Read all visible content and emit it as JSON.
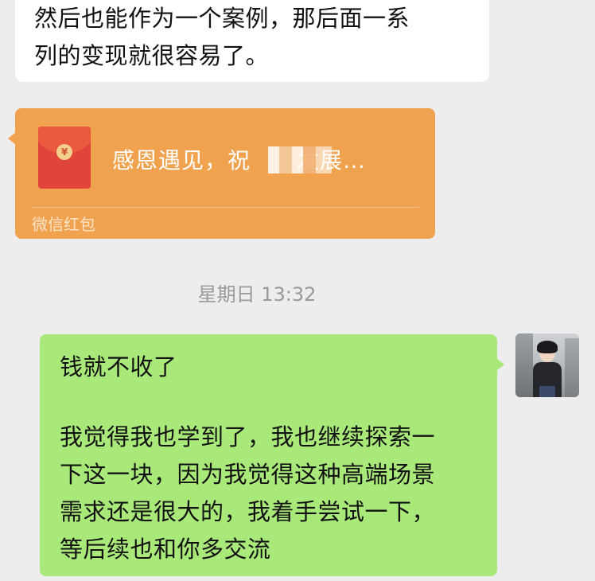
{
  "incoming_text": {
    "lines": [
      "然后也能作为一个案例，那后面一系",
      "列的变现就很容易了。"
    ]
  },
  "red_packet": {
    "title": "感恩遇见，祝",
    "title_end": "发展…",
    "footer": "微信红包",
    "icon": "red-envelope-icon",
    "colors": {
      "card": "#f0a24f",
      "envelope": "#e0443a"
    }
  },
  "timestamp": "星期日 13:32",
  "outgoing_message": {
    "lines": [
      "钱就不收了",
      "",
      "我觉得我也学到了，我也继续探索一",
      "下这一块，因为我觉得这种高端场景",
      "需求还是很大的，我着手尝试一下，",
      "等后续也和你多交流"
    ],
    "color": "#a9e97a"
  },
  "avatar": "user-avatar"
}
